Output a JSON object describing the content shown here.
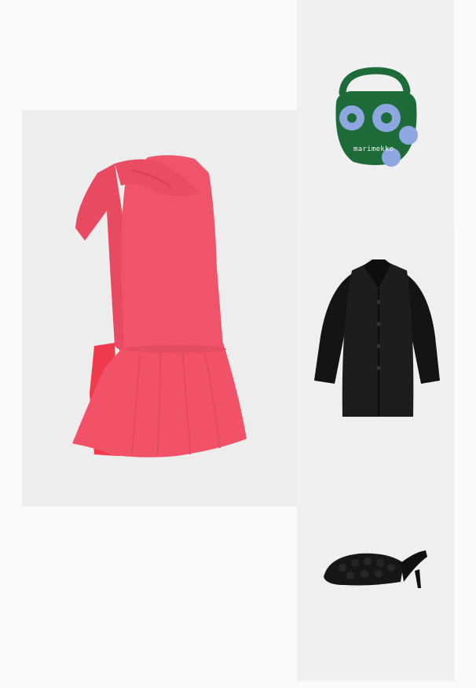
{
  "outfit": {
    "items": [
      {
        "id": "dress",
        "name": "coral-one-shoulder-bow-dress",
        "color": "#f0546a"
      },
      {
        "id": "bag",
        "name": "green-unikko-mini-bag",
        "color": "#1e6b3a",
        "print_color": "#8ea7e0",
        "brand_text": "marimekko"
      },
      {
        "id": "coat",
        "name": "black-taffeta-coat",
        "color": "#1a1a1a"
      },
      {
        "id": "shoe",
        "name": "black-woven-mule",
        "color": "#161616"
      }
    ]
  }
}
